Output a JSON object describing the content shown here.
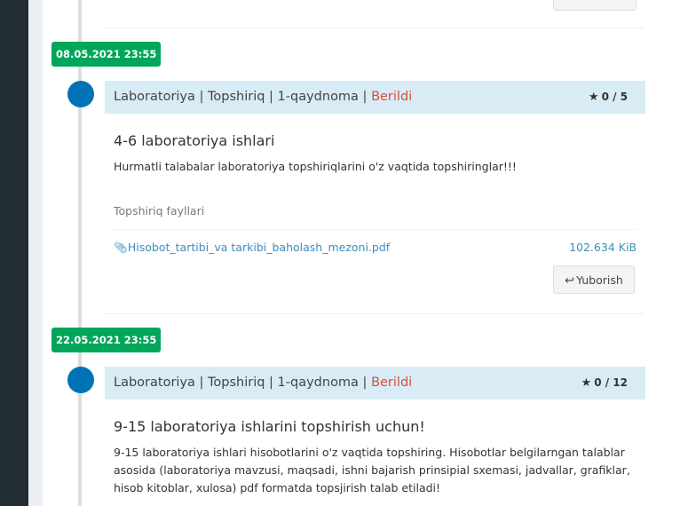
{
  "timeline": [
    {
      "date": "08.05.2021 23:55",
      "header": {
        "crumbs": "Laboratoriya | Topshiriq | 1-qaydnoma | ",
        "status": "Berildi",
        "score": "0 / 5"
      },
      "title": "4-6 laboratoriya ishlari",
      "text": "Hurmatli talabalar laboratoriya topshiriqlarini o'z vaqtida topshiringlar!!!",
      "files_label": "Topshiriq fayllari",
      "file": {
        "name": "Hisobot_tartibi_va tarkibi_baholash_mezoni.pdf",
        "size": "102.634 KiB"
      },
      "reply_label": "Yuborish"
    },
    {
      "date": "22.05.2021 23:55",
      "header": {
        "crumbs": "Laboratoriya | Topshiriq | 1-qaydnoma | ",
        "status": "Berildi",
        "score": "0 / 12"
      },
      "title": "9-15 laboratoriya ishlarini topshirish uchun!",
      "text": "9-15 laboratoriya ishlari hisobotlarini o'z vaqtida topshiring. Hisobotlar belgilarngan talablar asosida (laboratoriya mavzusi, maqsadi, ishni bajarish prinsipial sxemasi, jadvallar, grafiklar, hisob kitoblar, xulosa) pdf formatda topsjirish talab etiladi!"
    }
  ],
  "icons": {
    "star": "star-icon",
    "paperclip": "paperclip-icon",
    "reply": "reply-icon"
  },
  "colors": {
    "date_badge": "#00a65a",
    "dot": "#0073b7",
    "header_bg": "#d9ecf5",
    "status": "#dd4b39",
    "link": "#3c8dbc",
    "sidebar": "#222d32"
  }
}
